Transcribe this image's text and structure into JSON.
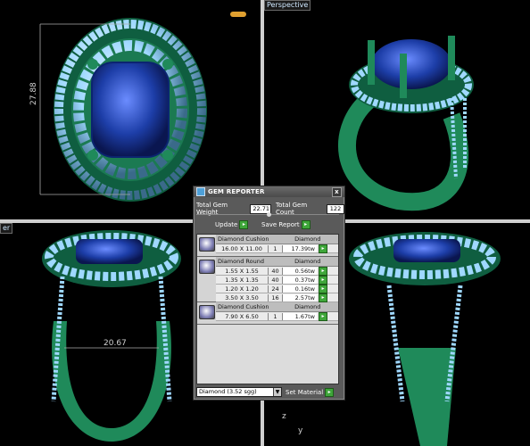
{
  "viewports": {
    "top_left_tab": "",
    "top_right_tab": "Perspective",
    "bottom_left_tab": "er",
    "height_dim": "27.88",
    "width_dim": "20.67",
    "axis_z": "z",
    "axis_y": "y"
  },
  "gem_reporter": {
    "title": "GEM REPORTER",
    "close_label": "x",
    "total_weight_label": "Total Gem Weight",
    "total_weight_value": "22.71",
    "total_count_label": "Total Gem Count",
    "total_count_value": "122",
    "update_label": "Update",
    "save_report_label": "Save Report",
    "groups": [
      {
        "shape": "Diamond Cushion",
        "material": "Diamond",
        "rows": [
          {
            "size": "16.00 X 11.00",
            "count": "1",
            "weight": "17.39tw"
          }
        ]
      },
      {
        "shape": "Diamond Round",
        "material": "Diamond",
        "rows": [
          {
            "size": "1.55 X 1.55",
            "count": "40",
            "weight": "0.56tw"
          },
          {
            "size": "1.35 X 1.35",
            "count": "40",
            "weight": "0.37tw"
          },
          {
            "size": "1.20 X 1.20",
            "count": "24",
            "weight": "0.16tw"
          },
          {
            "size": "3.50 X 3.50",
            "count": "16",
            "weight": "2.57tw"
          }
        ]
      },
      {
        "shape": "Diamond Cushion",
        "material": "Diamond",
        "rows": [
          {
            "size": "7.90 X 6.50",
            "count": "1",
            "weight": "1.67tw"
          }
        ]
      }
    ],
    "material_select": "Diamond    (3.52 sgg)",
    "set_material_label": "Set Material"
  },
  "colors": {
    "metal": "#1f8a5a",
    "sapphire": "#1d3ea8",
    "diamond": "#9fd8ff",
    "divider": "#cfcfcf"
  }
}
